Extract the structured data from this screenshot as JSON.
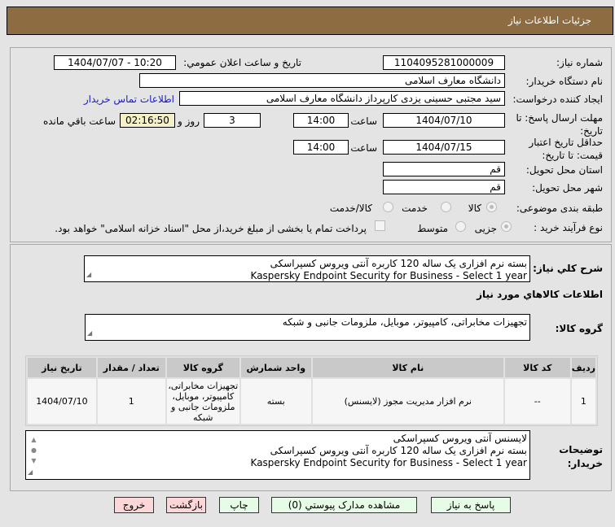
{
  "header": {
    "title": "جزئیات اطلاعات نیاز"
  },
  "form": {
    "need_number_label": "شماره نیاز:",
    "need_number": "1104095281000009",
    "announce_label": "تاریخ و ساعت اعلان عمومي:",
    "announce_value": "1404/07/07 - 10:20",
    "buyer_label": "نام دستگاه خریدار:",
    "buyer": "دانشگاه معارف اسلامی",
    "creator_label": "ایجاد کننده درخواست:",
    "creator": "سید مجتبی حسینی یزدی کارپرداز دانشگاه معارف اسلامی",
    "contact_link": "اطلاعات تماس خریدار",
    "deadline_label": "مهلت ارسال پاسخ: تا تاریخ:",
    "deadline_date": "1404/07/10",
    "time_label": "ساعت",
    "deadline_time": "14:00",
    "days": "3",
    "days_label": "روز و",
    "remaining": "02:16:50",
    "remaining_label": "ساعت باقي مانده",
    "validity_label": "حداقل تاریخ اعتبار قیمت: تا تاریخ:",
    "validity_date": "1404/07/15",
    "validity_time": "14:00",
    "province_label": "استان محل تحویل:",
    "province": "قم",
    "city_label": "شهر محل تحویل:",
    "city": "قم",
    "category_label": "طبقه بندی موضوعی:",
    "category_options": [
      "کالا",
      "خدمت",
      "کالا/خدمت"
    ],
    "process_label": "نوع فرآیند خرید :",
    "process_options": [
      "جزیی",
      "متوسط"
    ],
    "payment_note": "پرداخت تمام یا بخشی از مبلغ خرید،از محل \"اسناد خزانه اسلامی\" خواهد بود."
  },
  "details": {
    "summary_label": "شرح کلي نياز:",
    "summary_lines": [
      "بسته نرم افزاری یک ساله 120 کاربره آنتی ویروس کسپراسکی",
      "Kaspersky Endpoint Security for Business - Select  1 year"
    ],
    "goods_info_title": "اطلاعات کالاهاي مورد نياز",
    "group_label": "گروه کالا:",
    "group": "تجهیزات مخابراتی، کامپیوتر، موبایل، ملزومات جانبی و شبکه",
    "table": {
      "headers": [
        "ردیف",
        "کد کالا",
        "نام کالا",
        "واحد شمارش",
        "گروه کالا",
        "تعداد / مقدار",
        "تاریخ نیاز"
      ],
      "rows": [
        [
          "1",
          "--",
          "نرم افزار مدیریت مجوز (لایسنس)",
          "بسته",
          "تجهیزات مخابراتی، کامپیوتر، موبایل، ملزومات جانبی و شبکه",
          "1",
          "1404/07/10"
        ]
      ]
    },
    "notes_label": "توضیحات خریدار:",
    "notes_lines": [
      "لایسنس آنتی ویروس کسپراسکی",
      "بسته نرم افزاری یک ساله 120 کاربره آنتی ویروس کسپراسکی",
      "Kaspersky Endpoint Security for Business - Select  1 year"
    ]
  },
  "buttons": {
    "reply": "پاسخ به نیاز",
    "attachments": "مشاهده مدارک پیوستي (0)",
    "print": "چاپ",
    "back": "بازگشت",
    "exit": "خروج"
  }
}
